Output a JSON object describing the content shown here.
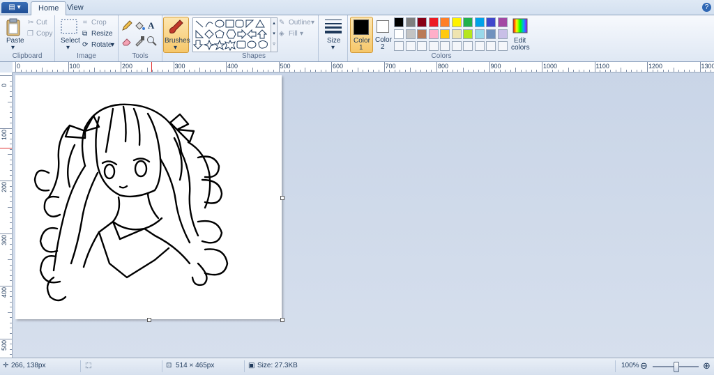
{
  "tabs": {
    "app_menu": "▤ ▾",
    "home": "Home",
    "view": "View"
  },
  "help_icon": "?",
  "clipboard": {
    "paste": "Paste",
    "cut": "Cut",
    "copy": "Copy",
    "group": "Clipboard"
  },
  "image": {
    "select": "Select",
    "crop": "Crop",
    "resize": "Resize",
    "rotate": "Rotate",
    "group": "Image"
  },
  "tools": {
    "group": "Tools",
    "brushes": "Brushes",
    "text_tool": "A"
  },
  "shapes": {
    "outline": "Outline",
    "fill": "Fill",
    "group": "Shapes"
  },
  "size": {
    "label": "Size"
  },
  "colors": {
    "color1": "Color",
    "color1_num": "1",
    "color2": "Color",
    "color2_num": "2",
    "edit": "Edit",
    "edit2": "colors",
    "group": "Colors",
    "row1": [
      "#000000",
      "#7f7f7f",
      "#880015",
      "#ed1c24",
      "#ff7f27",
      "#fff200",
      "#22b14c",
      "#00a2e8",
      "#3f48cc",
      "#a349a4"
    ],
    "row2": [
      "#ffffff",
      "#c3c3c3",
      "#b97a57",
      "#ffaec9",
      "#ffc90e",
      "#efe4b0",
      "#b5e61d",
      "#99d9ea",
      "#7092be",
      "#c8bfe7"
    ],
    "active_color1": "#000000",
    "active_color2": "#ffffff",
    "brushes_highlight": "#f9c86a"
  },
  "ruler": {
    "top": [
      "0",
      "100",
      "200",
      "300",
      "400",
      "500",
      "600",
      "700",
      "800",
      "900",
      "1000",
      "1100",
      "1200",
      "1300"
    ],
    "left": [
      "0",
      "100",
      "200",
      "300",
      "400",
      "500"
    ]
  },
  "status": {
    "cursor_pos": "266, 138px",
    "selection_size": "",
    "image_size": "514 × 465px",
    "file_size": "Size: 27.3KB",
    "zoom": "100%"
  }
}
